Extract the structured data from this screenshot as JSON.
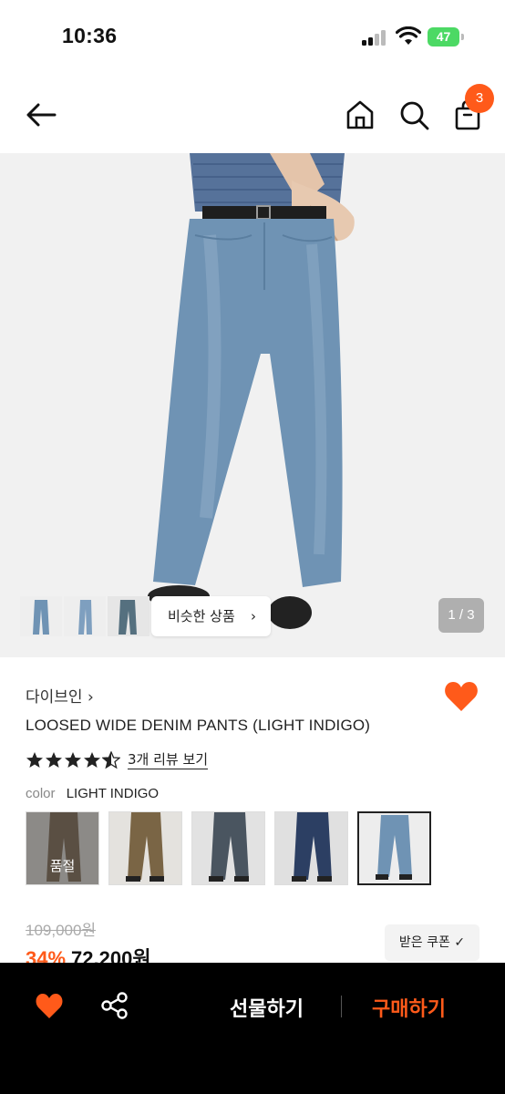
{
  "status_bar": {
    "time": "10:36",
    "battery": "47"
  },
  "header": {
    "cart_count": "3"
  },
  "gallery": {
    "similar_label": "비슷한 상품",
    "page_indicator": "1 / 3"
  },
  "product": {
    "brand": "다이브인 ›",
    "name": "LOOSED WIDE DENIM PANTS (LIGHT INDIGO)",
    "rating": 4.5,
    "review_link": "3개 리뷰 보기",
    "color_label": "color",
    "color_value": "LIGHT INDIGO",
    "soldout_label": "품절",
    "original_price": "109,000원",
    "discount": "34%",
    "sale_price": "72,200원",
    "coupon_label": "받은 쿠폰 ✓"
  },
  "bottom_bar": {
    "gift_label": "선물하기",
    "buy_label": "구매하기"
  },
  "colors": {
    "accent": "#ff5a1a",
    "badge": "#ff5a1a",
    "battery": "#4cd964"
  }
}
